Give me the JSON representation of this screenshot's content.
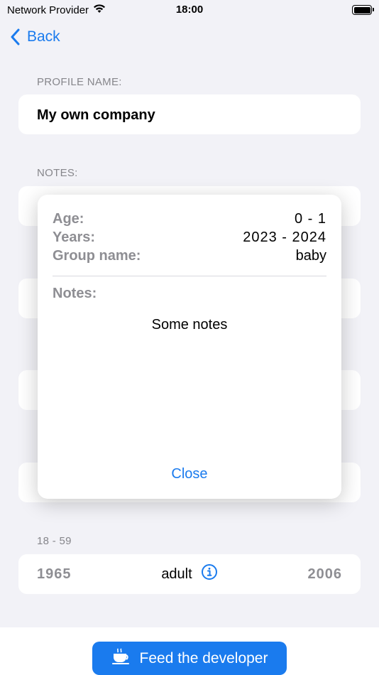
{
  "status_bar": {
    "carrier": "Network Provider",
    "time": "18:00"
  },
  "nav": {
    "back_label": "Back"
  },
  "profile": {
    "section_label": "PROFILE NAME:",
    "name_value": "My own company"
  },
  "notes": {
    "section_label": "NOTES:"
  },
  "age_group": {
    "range_label": "18 - 59",
    "start_year": "1965",
    "group_name": "adult",
    "end_year": "2006"
  },
  "footer": {
    "feed_button_label": "Feed the developer"
  },
  "modal": {
    "rows": [
      {
        "key": "Age:",
        "value": "0 - 1"
      },
      {
        "key": "Years:",
        "value": "2023 - 2024"
      },
      {
        "key": "Group name:",
        "value": "baby"
      }
    ],
    "notes_label": "Notes:",
    "notes_text": "Some notes",
    "close_label": "Close"
  },
  "colors": {
    "accent": "#1a7bee",
    "background": "#f2f2f7",
    "secondary_text": "#8e8e93"
  }
}
